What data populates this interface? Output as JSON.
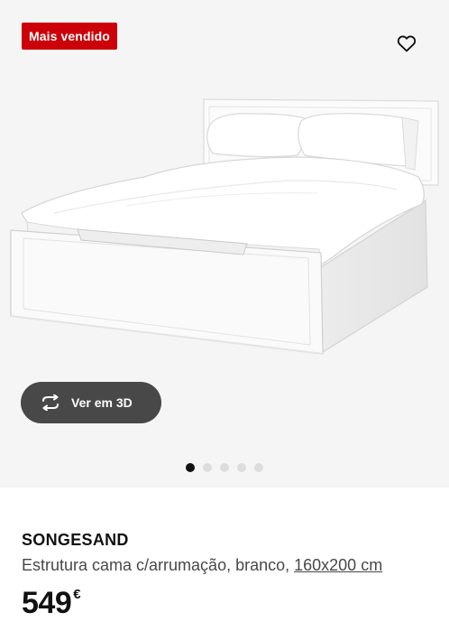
{
  "badge": {
    "label": "Mais vendido"
  },
  "favorite": {
    "icon": "heart-outline-icon"
  },
  "media": {
    "image": "white-storage-bed-frame",
    "view_3d": {
      "label": "Ver em 3D",
      "icon": "rotate-arrows-icon"
    },
    "carousel": {
      "count": 5,
      "active_index": 0
    }
  },
  "product": {
    "name": "SONGESAND",
    "description": "Estrutura cama c/arrumação, branco, ",
    "size": "160x200 cm",
    "price": {
      "amount": "549",
      "currency": "€"
    }
  },
  "colors": {
    "badge_bg": "#cc0008",
    "button_bg": "#484848",
    "image_bg": "#f5f5f5",
    "dot_active": "#111111",
    "dot_inactive": "#dddddd"
  }
}
